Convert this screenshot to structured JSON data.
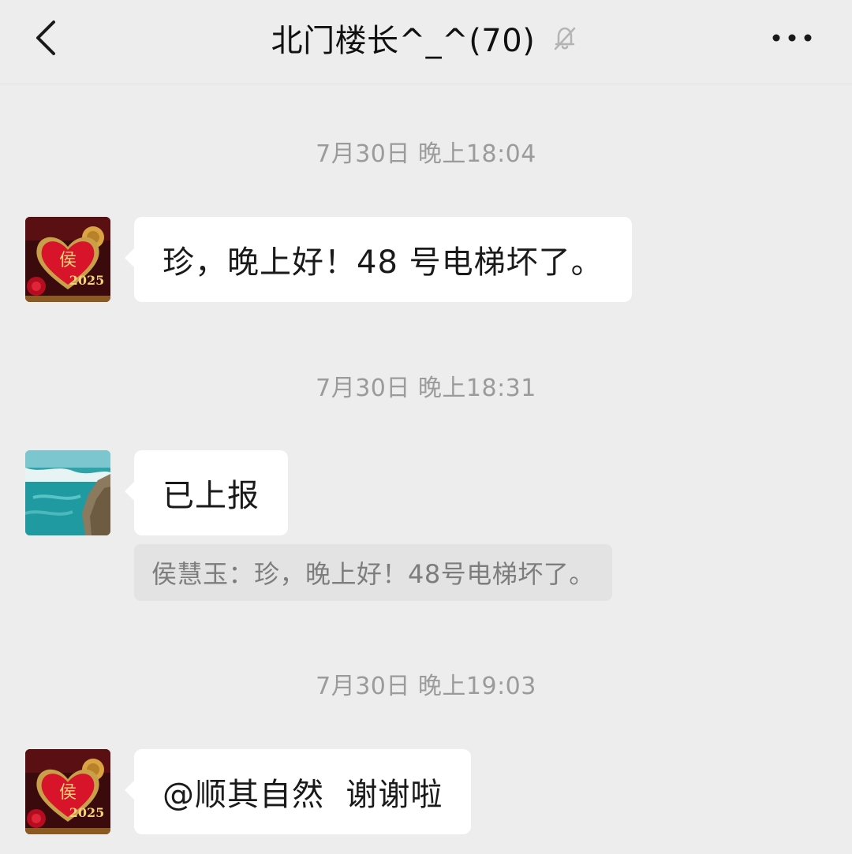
{
  "header": {
    "title": "北门楼长^_^(70)",
    "back_icon": "chevron-left-icon",
    "mute_icon": "bell-off-icon",
    "more_icon": "more-horizontal-icon"
  },
  "messages": [
    {
      "time": "7月30日 晚上18:04",
      "avatar": "heart-2025-avatar",
      "text": "珍，晚上好！48 号电梯坏了。"
    },
    {
      "time": "7月30日 晚上18:31",
      "avatar": "sea-cliff-avatar",
      "text": "已上报",
      "quote": "侯慧玉：珍，晚上好！48号电梯坏了。"
    },
    {
      "time": "7月30日 晚上19:03",
      "avatar": "heart-2025-avatar",
      "text": "@顺其自然  谢谢啦"
    }
  ],
  "colors": {
    "background": "#ededed",
    "bubble": "#ffffff",
    "quote_background": "#e3e3e3",
    "timestamp": "#9b9b9b",
    "heart_red": "#d8142a",
    "gold": "#d9a441",
    "sea": "#2fa4a8"
  }
}
